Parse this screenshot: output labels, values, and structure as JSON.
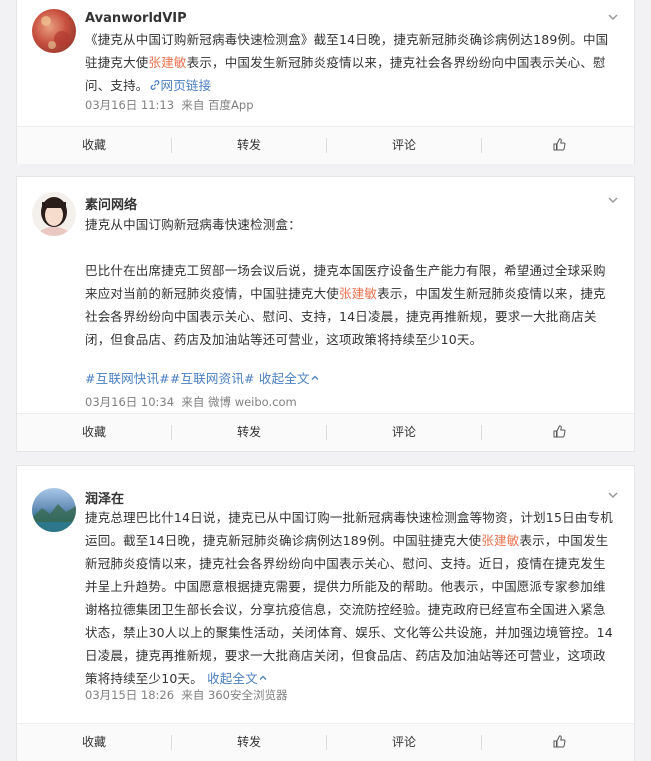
{
  "posts": [
    {
      "author": "AvanworldVIP",
      "text_1": "《捷克从中国订购新冠病毒快速检测盒》截至14日晚，捷克新冠肺炎确诊病例达189例。中国驻捷克大使",
      "highlight": "张建敏",
      "text_2": "表示，中国发生新冠肺炎疫情以来，捷克社会各界纷纷向中国表示关心、慰问、支持。",
      "link": "网页链接",
      "date": "03月16日 11:13",
      "source": "来自 百度App"
    },
    {
      "author": "素问网络",
      "intro": "捷克从中国订购新冠病毒快速检测盒：",
      "text_1": "巴比什在出席捷克工贸部一场会议后说，捷克本国医疗设备生产能力有限，希望通过全球采购来应对当前的新冠肺炎疫情，中国驻捷克大使",
      "highlight": "张建敏",
      "text_2": "表示，中国发生新冠肺炎疫情以来，捷克社会各界纷纷向中国表示关心、慰问、支持，14日凌晨，捷克再推新规，要求一大批商店关闭，但食品店、药店及加油站等还可营业，这项政策将持续至少10天。",
      "tag_1": "#互联网快讯#",
      "tag_2": "#互联网资讯#",
      "collapse": "收起全文",
      "date": "03月16日 10:34",
      "source": "来自 微博 weibo.com"
    },
    {
      "author": "润泽在",
      "text_1": "捷克总理巴比什14日说，捷克已从中国订购一批新冠病毒快速检测盒等物资，计划15日由专机运回。截至14日晚，捷克新冠肺炎确诊病例达189例。中国驻捷克大使",
      "highlight": "张建敏",
      "text_2": "表示，中国发生新冠肺炎疫情以来，捷克社会各界纷纷向中国表示关心、慰问、支持。近日，疫情在捷克发生并呈上升趋势。中国愿意根据捷克需要，提供力所能及的帮助。他表示，中国愿派专家参加维谢格拉德集团卫生部长会议，分享抗疫信息，交流防控经验。捷克政府已经宣布全国进入紧急状态，禁止30人以上的聚集性活动，关闭体育、娱乐、文化等公共设施，并加强边境管控。14日凌晨，捷克再推新规，要求一大批商店关闭，但食品店、药店及加油站等还可营业，这项政策将持续至少10天。",
      "collapse": "收起全文",
      "date": "03月15日 18:26",
      "source": "来自 360安全浏览器"
    }
  ],
  "actions": {
    "favorite": "收藏",
    "repost": "转发",
    "comment": "评论"
  },
  "icons": {
    "chevron": "chevron-down-icon",
    "like": "thumbs-up-icon",
    "link": "link-icon",
    "collapse_arrow": "chevron-up-icon"
  },
  "colors": {
    "highlight": "#eb7350",
    "link": "#4a7fc0",
    "meta": "#808080"
  }
}
